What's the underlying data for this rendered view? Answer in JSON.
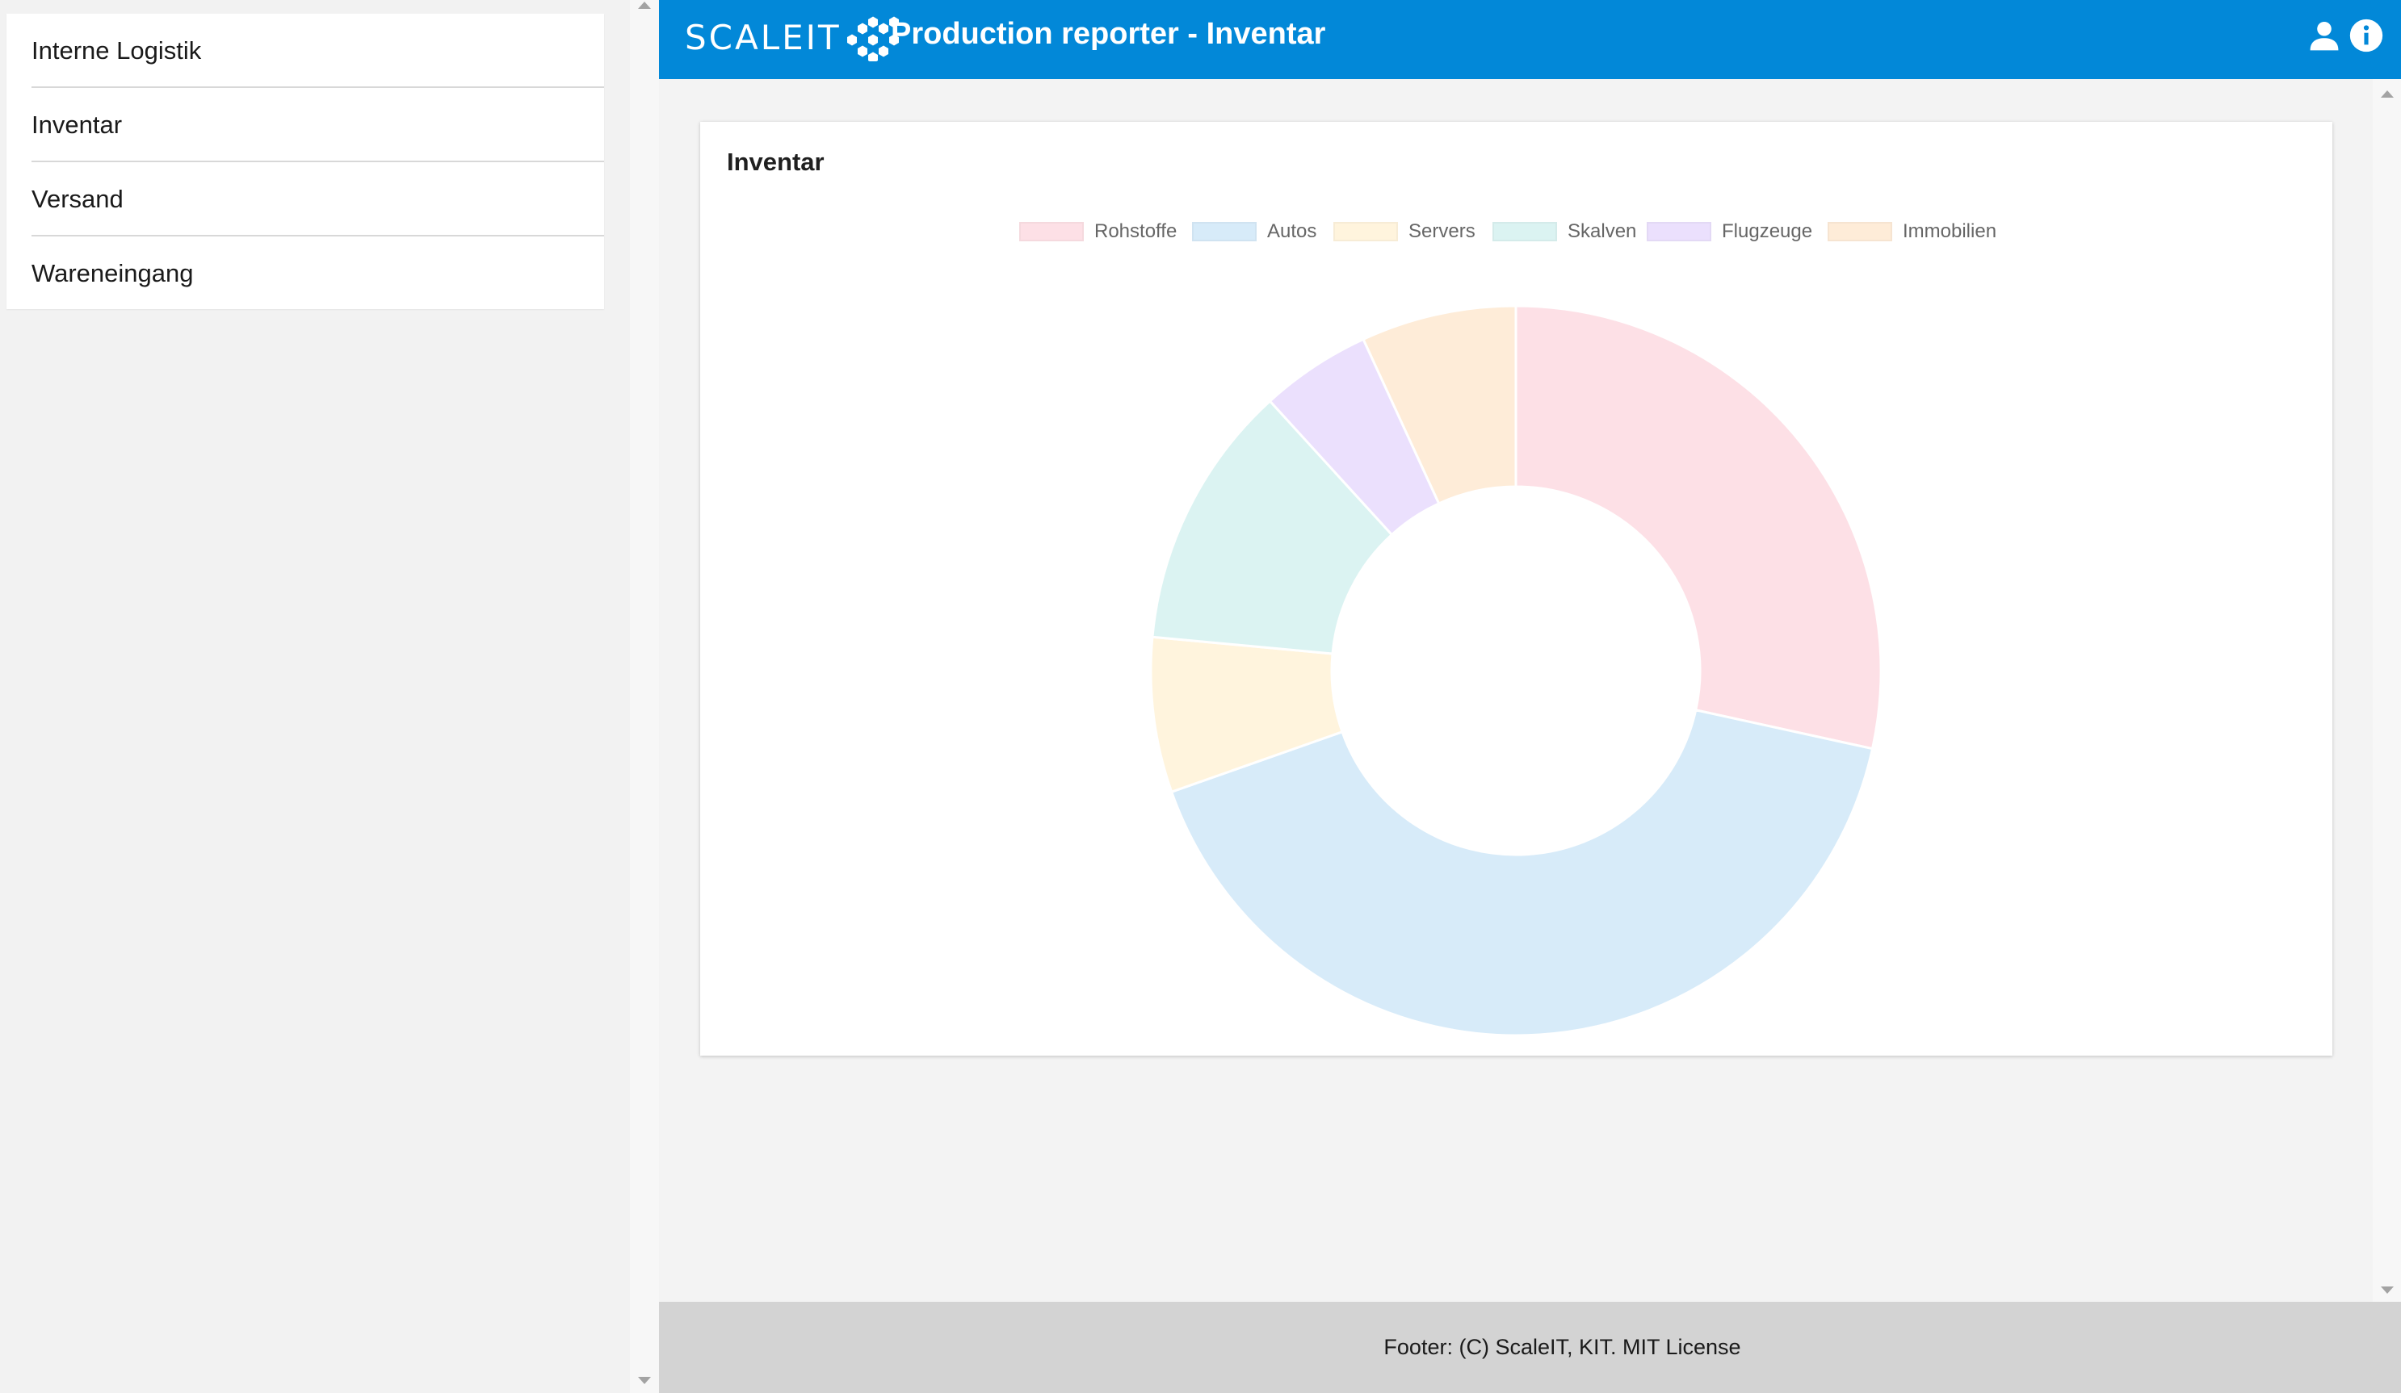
{
  "sidebar": {
    "items": [
      {
        "label": "Interne Logistik"
      },
      {
        "label": "Inventar"
      },
      {
        "label": "Versand"
      },
      {
        "label": "Wareneingang"
      }
    ]
  },
  "header": {
    "logo_text": "SCALEIT",
    "title": "Production reporter - Inventar",
    "icons": [
      "account-icon",
      "info-icon"
    ],
    "background_color": "#0288d8"
  },
  "card": {
    "title": "Inventar"
  },
  "chart_data": {
    "type": "doughnut",
    "title": "Inventar",
    "legend_position": "top",
    "categories": [
      "Rohstoffe",
      "Autos",
      "Servers",
      "Skalven",
      "Flugzeuge",
      "Immobilien"
    ],
    "values": [
      29,
      42,
      7,
      12,
      5,
      7
    ],
    "colors": [
      "#fde0e6",
      "#d7ebf9",
      "#fff4dd",
      "#dbf3f2",
      "#ebe0fd",
      "#feecd8"
    ]
  },
  "footer": {
    "text": "Footer: (C) ScaleIT, KIT. MIT License"
  }
}
